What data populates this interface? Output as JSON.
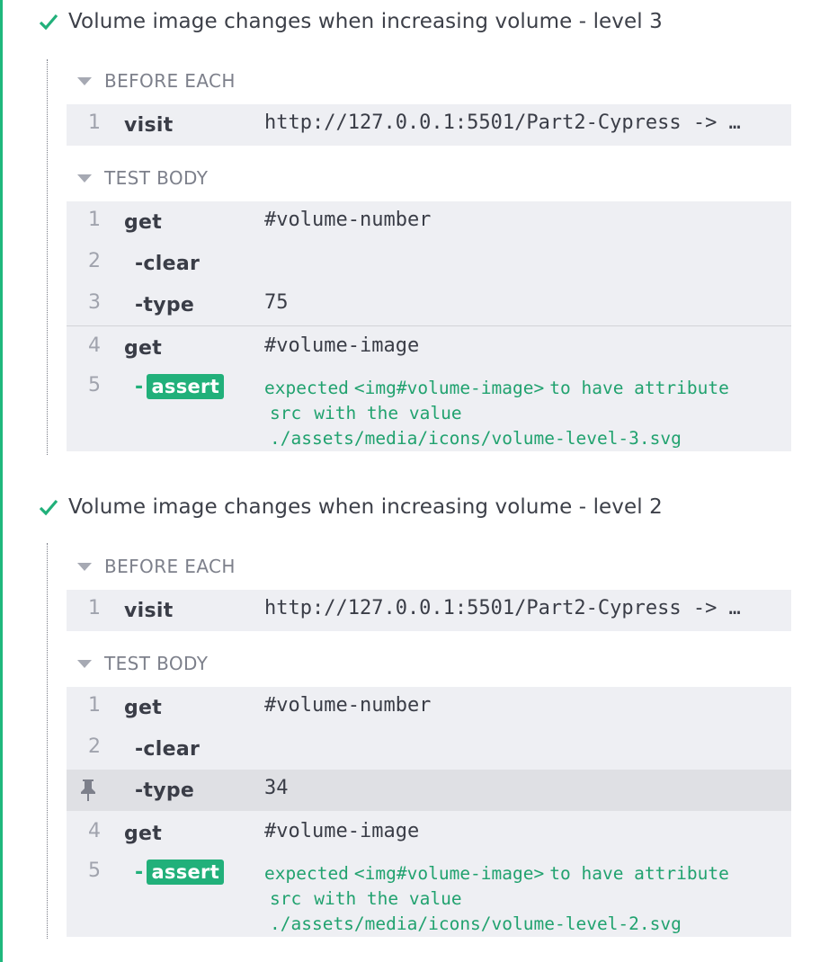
{
  "tests": [
    {
      "title": "Volume image changes when increasing volume - level 3",
      "before_each_label": "BEFORE EACH",
      "before_each": [
        {
          "num": "1",
          "cmd": "visit",
          "msg": "http://127.0.0.1:5501/Part2-Cypress -> …"
        }
      ],
      "test_body_label": "TEST BODY",
      "commands": [
        {
          "num": "1",
          "cmd": "get",
          "msg": "#volume-number"
        },
        {
          "num": "2",
          "cmd": "-clear",
          "msg": ""
        },
        {
          "num": "3",
          "cmd": "-type",
          "msg": "75"
        },
        {
          "num": "4",
          "cmd": "get",
          "msg": "#volume-image"
        }
      ],
      "assert": {
        "num": "5",
        "dash": "-",
        "label": "assert",
        "expected": "expected",
        "subject": "<img#volume-image>",
        "to_have": "to have attribute",
        "attr": "src",
        "with_value": "with the value",
        "value": "./assets/media/icons/volume-level-3.svg"
      }
    },
    {
      "title": "Volume image changes when increasing volume - level 2",
      "before_each_label": "BEFORE EACH",
      "before_each": [
        {
          "num": "1",
          "cmd": "visit",
          "msg": "http://127.0.0.1:5501/Part2-Cypress -> …"
        }
      ],
      "test_body_label": "TEST BODY",
      "commands": [
        {
          "num": "1",
          "cmd": "get",
          "msg": "#volume-number"
        },
        {
          "num": "2",
          "cmd": "-clear",
          "msg": ""
        },
        {
          "num": "",
          "cmd": "-type",
          "msg": "34",
          "pinned": true,
          "icon": "pin-icon"
        },
        {
          "num": "4",
          "cmd": "get",
          "msg": "#volume-image"
        }
      ],
      "assert": {
        "num": "5",
        "dash": "-",
        "label": "assert",
        "expected": "expected",
        "subject": "<img#volume-image>",
        "to_have": "to have attribute",
        "attr": "src",
        "with_value": "with the value",
        "value": "./assets/media/icons/volume-level-2.svg"
      }
    }
  ],
  "colors": {
    "pass": "#21b07a",
    "row_bg": "#eeeff3",
    "pinned_bg": "#dfe0e4"
  }
}
